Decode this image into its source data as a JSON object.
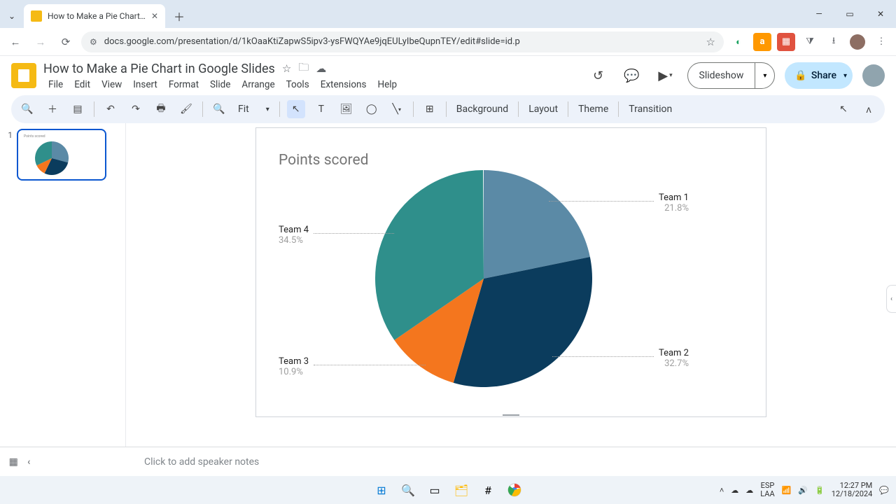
{
  "browser": {
    "tab_title": "How to Make a Pie Chart in Go…",
    "url": "docs.google.com/presentation/d/1kOaaKtiZapwS5ipv3-ysFWQYAe9jqEULyIbeQupnTEY/edit#slide=id.p"
  },
  "doc": {
    "title": "How to Make a Pie Chart in Google Slides",
    "menu": [
      "File",
      "Edit",
      "View",
      "Insert",
      "Format",
      "Slide",
      "Arrange",
      "Tools",
      "Extensions",
      "Help"
    ],
    "slideshow_label": "Slideshow",
    "share_label": "Share"
  },
  "toolbar": {
    "zoom_label": "Fit",
    "background": "Background",
    "layout": "Layout",
    "theme": "Theme",
    "transition": "Transition"
  },
  "thumb": {
    "number": "1"
  },
  "notes": {
    "placeholder": "Click to add speaker notes"
  },
  "system": {
    "lang1": "ESP",
    "lang2": "LAA",
    "time": "12:27 PM",
    "date": "12/18/2024"
  },
  "chart_data": {
    "type": "pie",
    "title": "Points scored",
    "series": [
      {
        "name": "Team 1",
        "pct": 21.8,
        "color": "#5b8aa6"
      },
      {
        "name": "Team 2",
        "pct": 32.7,
        "color": "#0b3c5d"
      },
      {
        "name": "Team 3",
        "pct": 10.9,
        "color": "#f4761e"
      },
      {
        "name": "Team 4",
        "pct": 34.5,
        "color": "#2f8f8b"
      }
    ],
    "labels": {
      "t1": {
        "name": "Team 1",
        "pct": "21.8%"
      },
      "t2": {
        "name": "Team 2",
        "pct": "32.7%"
      },
      "t3": {
        "name": "Team 3",
        "pct": "10.9%"
      },
      "t4": {
        "name": "Team 4",
        "pct": "34.5%"
      }
    }
  }
}
